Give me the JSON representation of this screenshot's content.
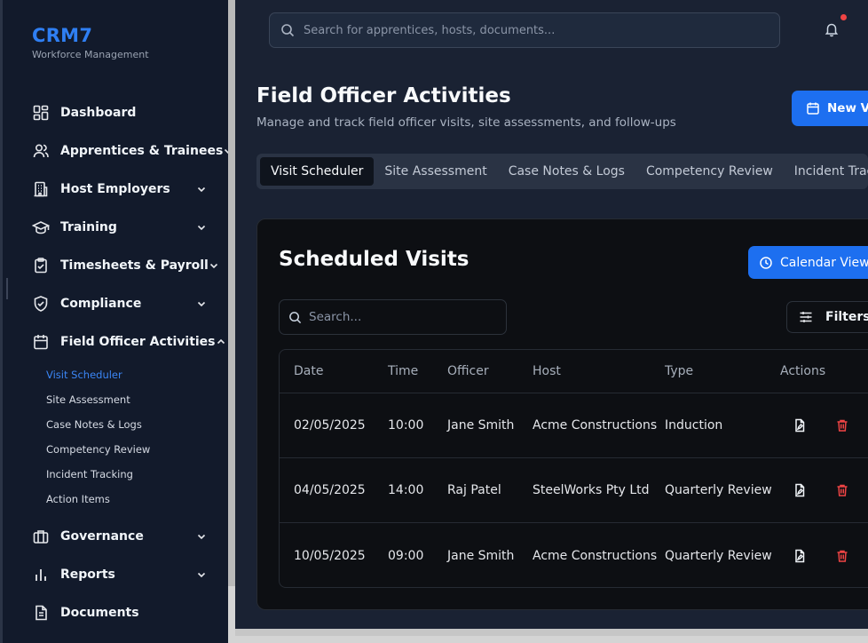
{
  "app": {
    "name": "CRM7",
    "tagline": "Workforce Management"
  },
  "sidebar": {
    "items": [
      {
        "label": "Dashboard",
        "icon": "dashboard-icon",
        "expandable": false
      },
      {
        "label": "Apprentices & Trainees",
        "icon": "users-icon",
        "expandable": true
      },
      {
        "label": "Host Employers",
        "icon": "building-icon",
        "expandable": true
      },
      {
        "label": "Training",
        "icon": "graduation-cap-icon",
        "expandable": true
      },
      {
        "label": "Timesheets & Payroll",
        "icon": "clipboard-check-icon",
        "expandable": true
      },
      {
        "label": "Compliance",
        "icon": "shield-check-icon",
        "expandable": true
      },
      {
        "label": "Field Officer Activities",
        "icon": "calendar-icon",
        "expandable": true,
        "expanded": true
      },
      {
        "label": "Governance",
        "icon": "briefcase-icon",
        "expandable": true
      },
      {
        "label": "Reports",
        "icon": "bar-chart-icon",
        "expandable": true
      },
      {
        "label": "Documents",
        "icon": "document-icon",
        "expandable": false
      }
    ],
    "field_officer_sub": [
      {
        "label": "Visit Scheduler",
        "active": true
      },
      {
        "label": "Site Assessment"
      },
      {
        "label": "Case Notes & Logs"
      },
      {
        "label": "Competency Review"
      },
      {
        "label": "Incident Tracking"
      },
      {
        "label": "Action Items"
      }
    ]
  },
  "header": {
    "search_placeholder": "Search for apprentices, hosts, documents...",
    "has_notifications": true
  },
  "page": {
    "title": "Field Officer Activities",
    "subtitle": "Manage and track field officer visits, site assessments, and follow-ups",
    "new_button": "New Visit",
    "tabs": [
      "Visit Scheduler",
      "Site Assessment",
      "Case Notes & Logs",
      "Competency Review",
      "Incident Tracking"
    ],
    "active_tab": "Visit Scheduler"
  },
  "visits": {
    "title": "Scheduled Visits",
    "calendar_button": "Calendar View",
    "search_placeholder": "Search...",
    "filters_button": "Filters",
    "columns": [
      "Date",
      "Time",
      "Officer",
      "Host",
      "Type",
      "Actions"
    ],
    "rows": [
      {
        "date": "02/05/2025",
        "time": "10:00",
        "officer": "Jane Smith",
        "host": "Acme Constructions",
        "type": "Induction"
      },
      {
        "date": "04/05/2025",
        "time": "14:00",
        "officer": "Raj Patel",
        "host": "SteelWorks Pty Ltd",
        "type": "Quarterly Review"
      },
      {
        "date": "10/05/2025",
        "time": "09:00",
        "officer": "Jane Smith",
        "host": "Acme Constructions",
        "type": "Quarterly Review"
      }
    ]
  },
  "colors": {
    "accent": "#1d6ff0",
    "brand": "#2f7ff3",
    "danger": "#ef4444",
    "sidebar": "#121a2b",
    "card": "#0d0f13"
  }
}
